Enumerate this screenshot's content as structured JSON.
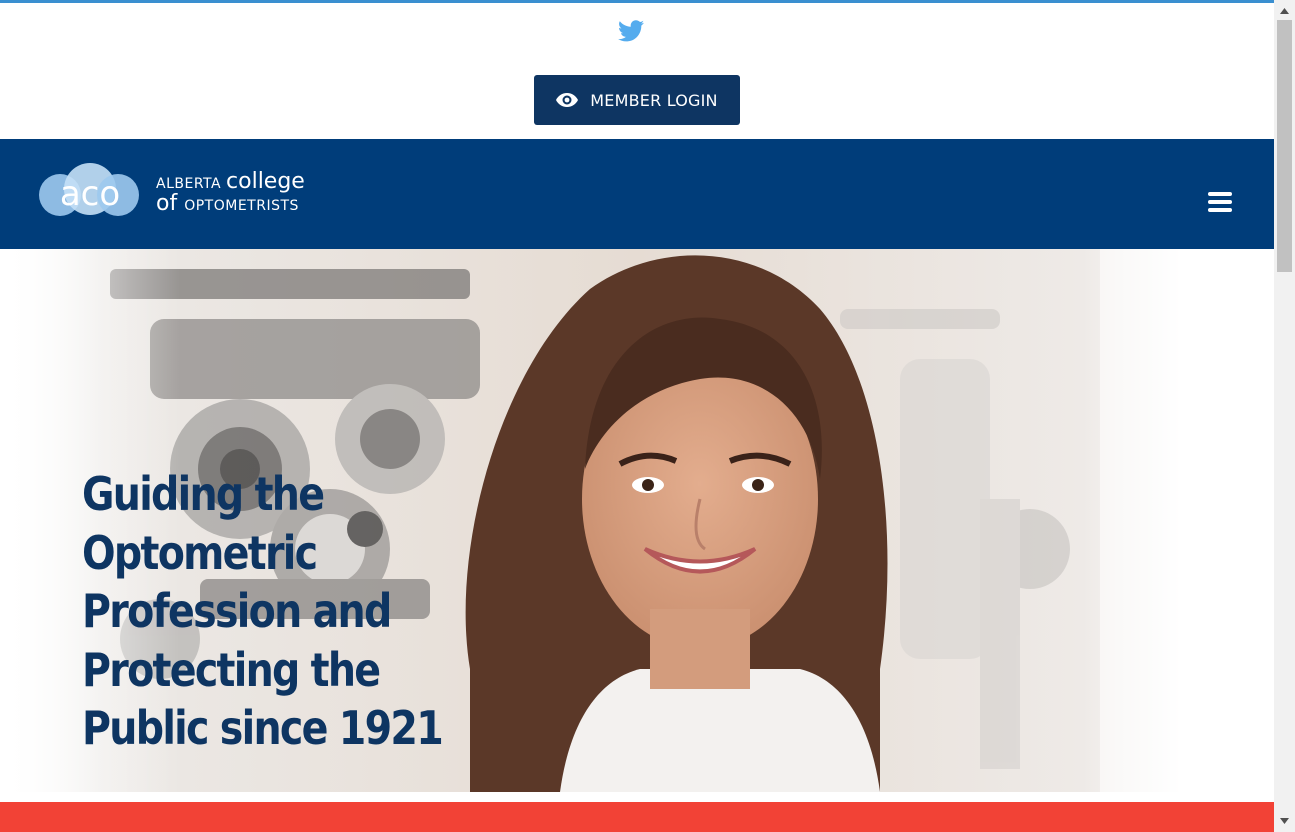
{
  "colors": {
    "accent_line": "#3a8fd0",
    "navy": "#003d7a",
    "button_bg": "#0e3562",
    "headline": "#0e3562",
    "twitter": "#55acee",
    "red_band": "#f24236"
  },
  "header": {
    "social_icon": "twitter-icon",
    "login_icon": "eye-icon",
    "login_label": "MEMBER LOGIN"
  },
  "navbar": {
    "logo_mark": "aco",
    "logo_word1": "ALBERTA",
    "logo_word2": "college",
    "logo_word3": "of",
    "logo_word4": "OPTOMETRISTS",
    "menu_icon": "hamburger-menu-icon"
  },
  "hero": {
    "image": "smiling optometrist with phoropter in background",
    "title": "Guiding the Optometric Profession and Protecting the Public since 1921"
  }
}
